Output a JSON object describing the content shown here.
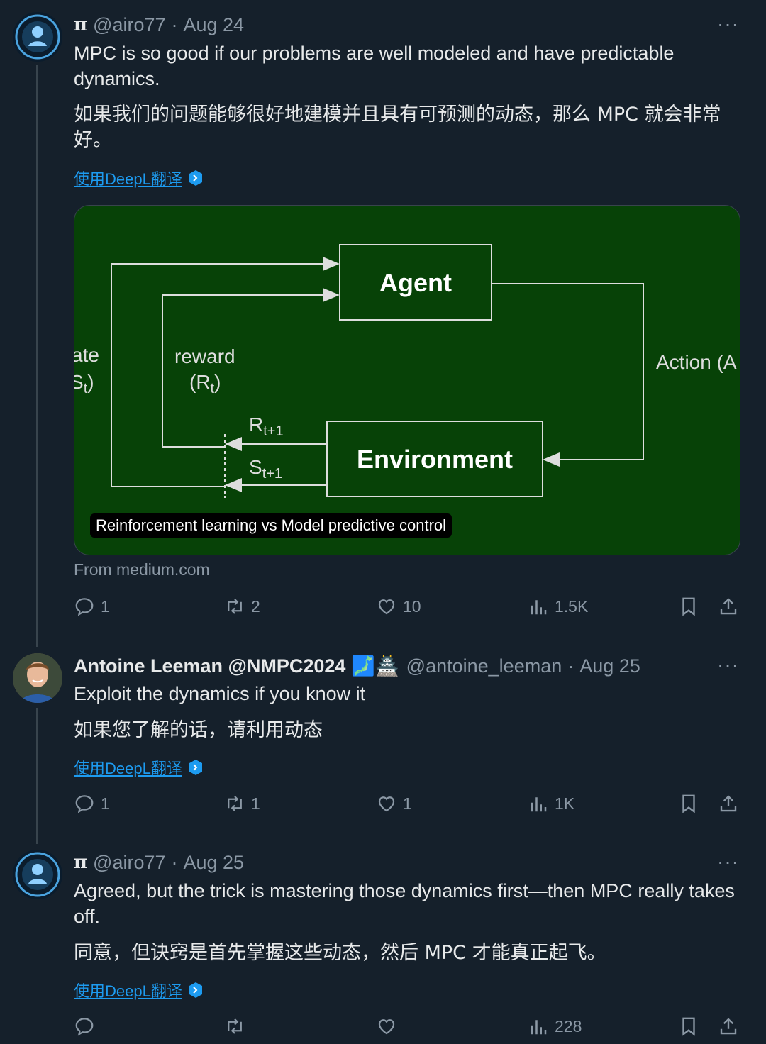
{
  "tweets": [
    {
      "handle": "@airo77",
      "pi": "π",
      "date": "Aug 24",
      "text": "MPC is so good if our problems are well modeled and have predictable dynamics.",
      "translation": "如果我们的问题能够很好地建模并且具有可预测的动态，那么 MPC 就会非常好。",
      "translate_link": "使用DeepL翻译",
      "card": {
        "agent": "Agent",
        "environment": "Environment",
        "state_label_1": "ate",
        "state_label_2": "S",
        "state_label_2_sub": "t",
        "state_label_2_close": ")",
        "reward": "reward",
        "reward_r": "(R",
        "reward_r_sub": "t",
        "reward_close": ")",
        "r_next": "R",
        "r_next_sub": "t+1",
        "s_next": "S",
        "s_next_sub": "t+1",
        "action": "Action (A",
        "caption": "Reinforcement learning vs Model predictive control"
      },
      "source": "From medium.com",
      "replies": "1",
      "reposts": "2",
      "likes": "10",
      "views": "1.5K"
    },
    {
      "display_name": "Antoine Leeman @NMPC2024",
      "emoji": "🗾🏯",
      "handle": "@antoine_leeman",
      "date": "Aug 25",
      "text": "Exploit the dynamics if you know it",
      "translation": "如果您了解的话，请利用动态",
      "translate_link": "使用DeepL翻译",
      "replies": "1",
      "reposts": "1",
      "likes": "1",
      "views": "1K"
    },
    {
      "handle": "@airo77",
      "pi": "π",
      "date": "Aug 25",
      "text": "Agreed, but the trick is mastering those dynamics first—then MPC really takes off.",
      "translation": "同意，但诀窍是首先掌握这些动态，然后 MPC 才能真正起飞。",
      "translate_link": "使用DeepL翻译",
      "views": "228"
    }
  ],
  "separator": "·",
  "more_icon": "···",
  "colors": {
    "background": "#15202b",
    "link": "#1d9bf0",
    "muted": "#8b98a5",
    "card_bg": "#074207"
  }
}
